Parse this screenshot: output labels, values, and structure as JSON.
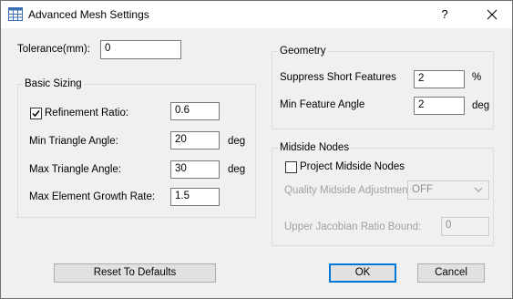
{
  "window": {
    "title": "Advanced Mesh Settings",
    "help_label": "?"
  },
  "tolerance": {
    "label": "Tolerance(mm):",
    "value": "0"
  },
  "basic_sizing": {
    "caption": "Basic Sizing",
    "refinement_ratio": {
      "label": "Refinement Ratio:",
      "value": "0.6",
      "checked": true
    },
    "min_triangle_angle": {
      "label": "Min Triangle Angle:",
      "value": "20",
      "unit": "deg"
    },
    "max_triangle_angle": {
      "label": "Max Triangle Angle:",
      "value": "30",
      "unit": "deg"
    },
    "max_element_growth_rate": {
      "label": "Max Element Growth Rate:",
      "value": "1.5"
    }
  },
  "geometry": {
    "caption": "Geometry",
    "suppress_short_features": {
      "label": "Suppress Short Features",
      "value": "2",
      "unit": "%"
    },
    "min_feature_angle": {
      "label": "Min Feature Angle",
      "value": "2",
      "unit": "deg"
    }
  },
  "midside_nodes": {
    "caption": "Midside Nodes",
    "project_midside_nodes": {
      "label": "Project Midside Nodes",
      "checked": false
    },
    "quality_midside_adjustment": {
      "label": "Quality Midside Adjustment:",
      "value": "OFF"
    },
    "upper_jacobian_ratio_bound": {
      "label": "Upper Jacobian Ratio Bound:",
      "value": "0"
    }
  },
  "buttons": {
    "reset": "Reset To Defaults",
    "ok": "OK",
    "cancel": "Cancel"
  },
  "colors": {
    "focus_border": "#0078d7",
    "dialog_bg": "#f0f0f0"
  }
}
